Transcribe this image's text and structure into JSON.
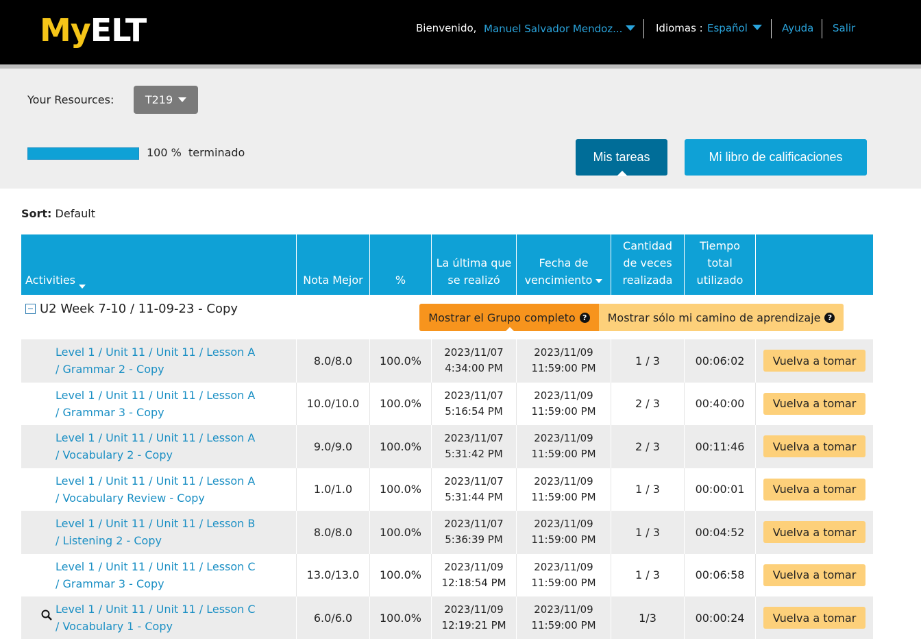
{
  "header": {
    "logo_my": "My",
    "logo_elt": "ELT",
    "welcome": "Bienvenido,",
    "user_name": "Manuel Salvador Mendoz...",
    "lang_label": "Idiomas :",
    "lang_value": "Español",
    "help": "Ayuda",
    "exit": "Salir",
    "link_color": "#2aa4dc"
  },
  "resources": {
    "label": "Your Resources:",
    "selected": "T219",
    "progress_value": "100 %",
    "progress_word": "terminado",
    "progress_fraction": 1.0
  },
  "buttons": {
    "tasks": "Mis tareas",
    "grades": "Mi libro de calificaciones"
  },
  "sort": {
    "label": "Sort:",
    "value": "Default"
  },
  "table": {
    "headers": {
      "activities": "Activities",
      "best": "Nota Mejor",
      "pct": "%",
      "last": "La última que se realizó",
      "due": "Fecha de vencimiento",
      "count": "Cantidad de veces realizada",
      "time": "Tiempo total utilizado"
    },
    "group": {
      "title": "U2 Week 7-10  /  11-09-23 - Copy",
      "show_full": "Mostrar el Grupo completo",
      "show_path": "Mostrar sólo mi camino de aprendizaje"
    },
    "retake_label": "Vuelva a tomar",
    "rows": [
      {
        "line1": "Level 1 / Unit 11 / Unit 11 / Lesson A",
        "line2": "/ Grammar 2 - Copy",
        "best": "8.0/8.0",
        "pct": "100.0%",
        "last_date": "2023/11/07",
        "last_time": "4:34:00 PM",
        "due_date": "2023/11/09",
        "due_time": "11:59:00 PM",
        "count": "1 / 3",
        "time": "00:06:02"
      },
      {
        "line1": "Level 1 / Unit 11 / Unit 11 / Lesson A",
        "line2": "/ Grammar 3 - Copy",
        "best": "10.0/10.0",
        "pct": "100.0%",
        "last_date": "2023/11/07",
        "last_time": "5:16:54 PM",
        "due_date": "2023/11/09",
        "due_time": "11:59:00 PM",
        "count": "2 / 3",
        "time": "00:40:00"
      },
      {
        "line1": "Level 1 / Unit 11 / Unit 11 / Lesson A",
        "line2": "/ Vocabulary 2 - Copy",
        "best": "9.0/9.0",
        "pct": "100.0%",
        "last_date": "2023/11/07",
        "last_time": "5:31:42 PM",
        "due_date": "2023/11/09",
        "due_time": "11:59:00 PM",
        "count": "2 / 3",
        "time": "00:11:46"
      },
      {
        "line1": "Level 1 / Unit 11 / Unit 11 / Lesson A",
        "line2": "/ Vocabulary Review - Copy",
        "best": "1.0/1.0",
        "pct": "100.0%",
        "last_date": "2023/11/07",
        "last_time": "5:31:44 PM",
        "due_date": "2023/11/09",
        "due_time": "11:59:00 PM",
        "count": "1 / 3",
        "time": "00:00:01"
      },
      {
        "line1": "Level 1 / Unit 11 / Unit 11 / Lesson B",
        "line2": "/ Listening 2 - Copy",
        "best": "8.0/8.0",
        "pct": "100.0%",
        "last_date": "2023/11/07",
        "last_time": "5:36:39 PM",
        "due_date": "2023/11/09",
        "due_time": "11:59:00 PM",
        "count": "1 / 3",
        "time": "00:04:52"
      },
      {
        "line1": "Level 1 / Unit 11 / Unit 11 / Lesson C",
        "line2": "/ Grammar 3 - Copy",
        "best": "13.0/13.0",
        "pct": "100.0%",
        "last_date": "2023/11/09",
        "last_time": "12:18:54 PM",
        "due_date": "2023/11/09",
        "due_time": "11:59:00 PM",
        "count": "1 / 3",
        "time": "00:06:58"
      },
      {
        "line1": "Level 1 / Unit 11 / Unit 11 / Lesson C",
        "line2": "/ Vocabulary 1 - Copy",
        "best": "6.0/6.0",
        "pct": "100.0%",
        "last_date": "2023/11/09",
        "last_time": "12:19:21 PM",
        "due_date": "2023/11/09",
        "due_time": "11:59:00 PM",
        "count": "1/3",
        "time": "00:00:24",
        "search_icon": "search-icon"
      }
    ]
  }
}
